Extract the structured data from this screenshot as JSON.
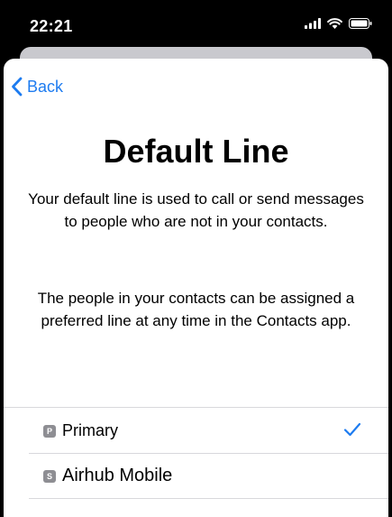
{
  "status": {
    "time": "22:21",
    "icons": [
      "signal-icon",
      "wifi-icon",
      "battery-icon"
    ]
  },
  "nav": {
    "back_label": "Back"
  },
  "title": "Default Line",
  "description_1": "Your default line is used to call or send messages to people who are not in your contacts.",
  "description_2": "The people in your contacts can be assigned a preferred line at any time in the Contacts app.",
  "lines": [
    {
      "badge": "P",
      "label": "Primary",
      "selected": true
    },
    {
      "badge": "S",
      "label": "Airhub Mobile",
      "selected": false
    }
  ],
  "colors": {
    "accent": "#1e7cf0",
    "badge": "#8e8e93"
  }
}
